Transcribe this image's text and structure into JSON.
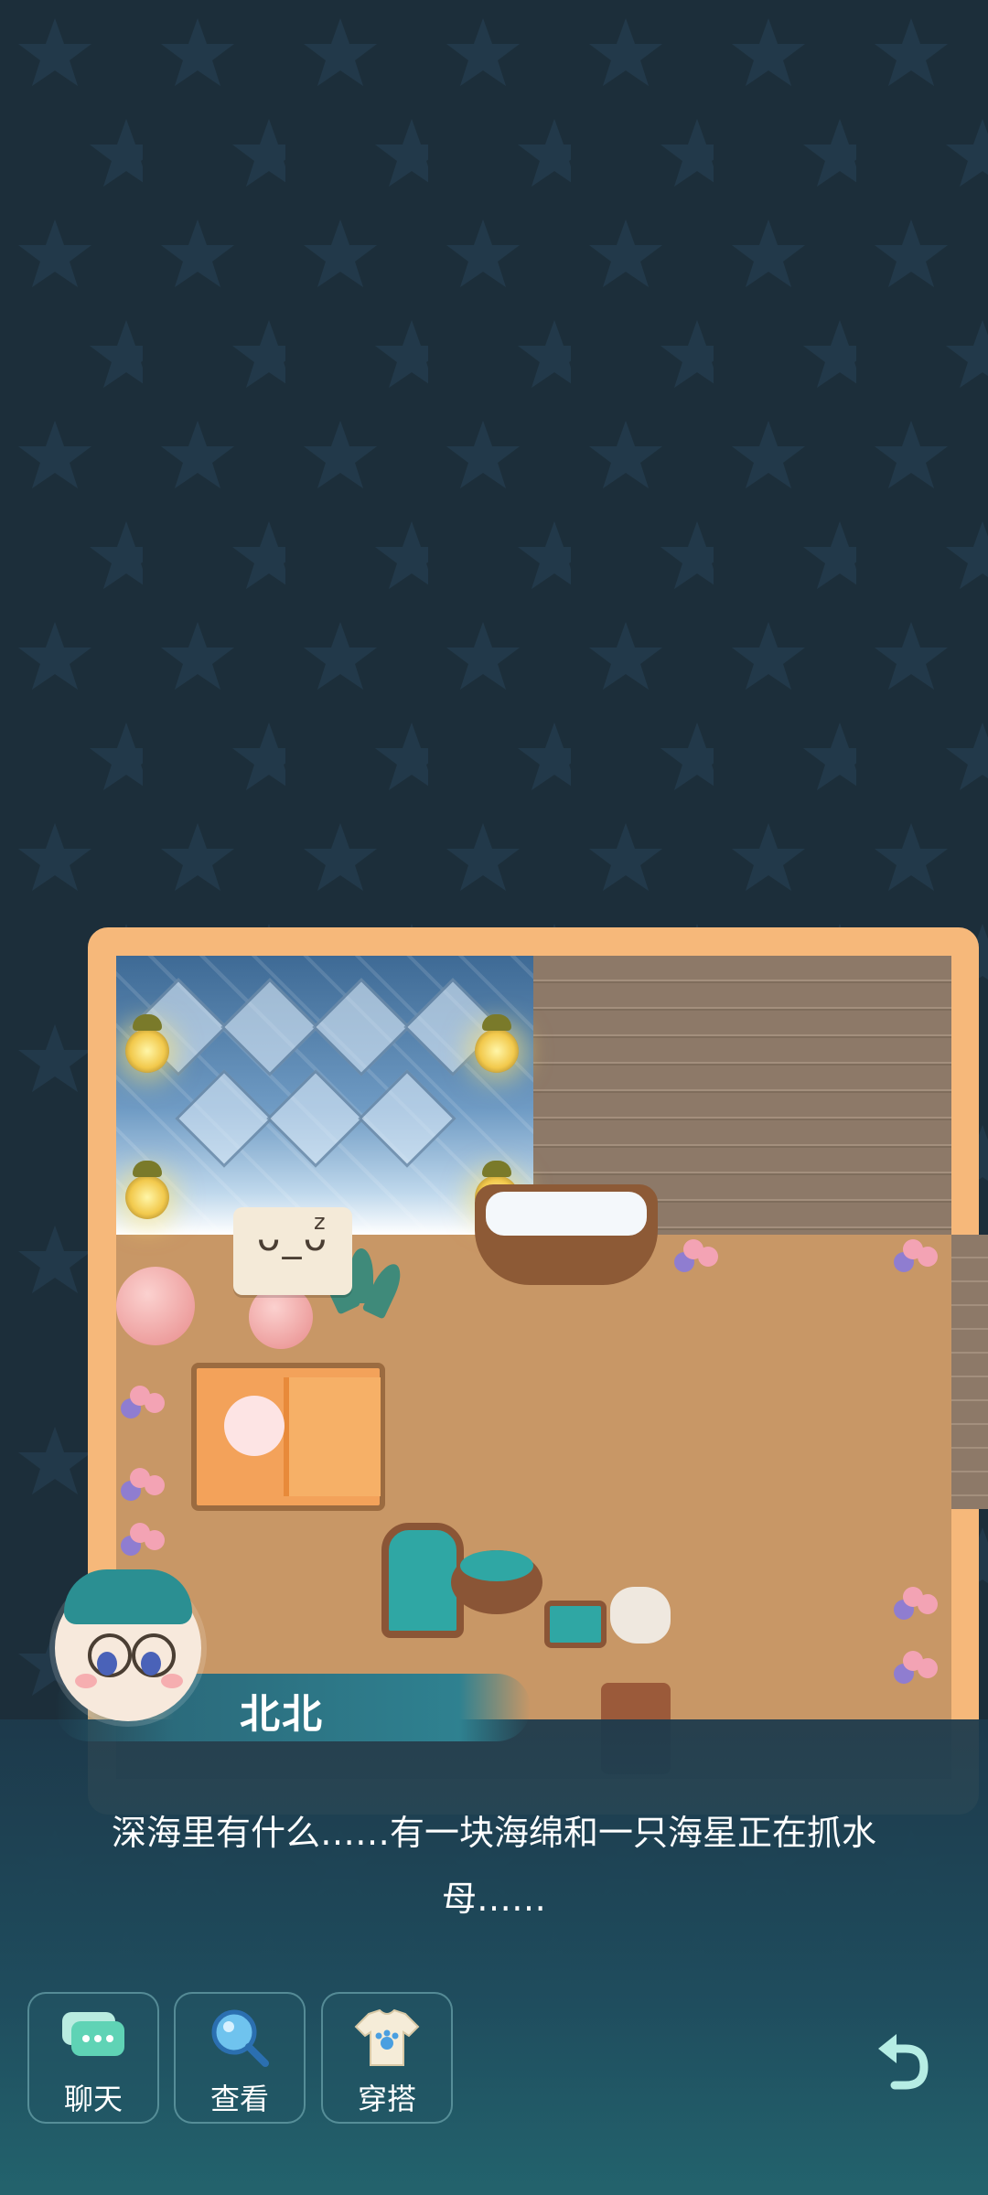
{
  "character": {
    "name": "北北",
    "sleep_face": "ᴗ_ᴗ",
    "sleep_z": "z"
  },
  "dialogue": {
    "text": "深海里有什么……有一块海绵和一只海星正在抓水母……"
  },
  "actions": [
    {
      "label": "聊天",
      "icon": "chat-icon"
    },
    {
      "label": "查看",
      "icon": "magnifier-icon"
    },
    {
      "label": "穿搭",
      "icon": "shirt-icon"
    }
  ],
  "controls": {
    "undo_icon": "undo-icon"
  },
  "colors": {
    "background": "#1c2e3a",
    "room_frame": "#f6b87a",
    "floor": "#c89766",
    "dialog": "#1f4d5e",
    "accent": "#2f8190"
  }
}
